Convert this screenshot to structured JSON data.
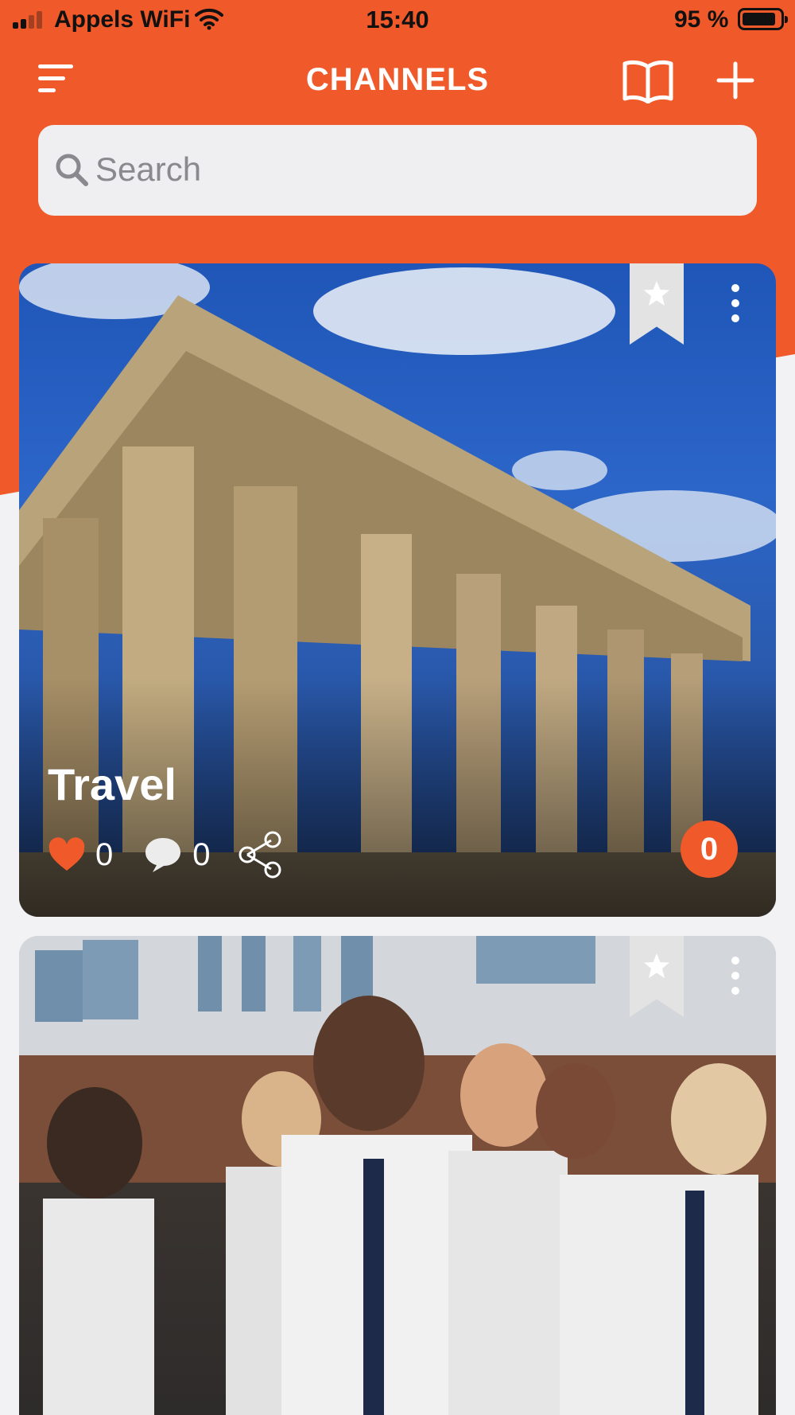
{
  "status_bar": {
    "carrier": "Appels WiFi",
    "time": "15:40",
    "battery": "95 %"
  },
  "header": {
    "title": "CHANNELS",
    "menu_icon": "hamburger-menu-icon",
    "book_icon": "open-book-icon",
    "add_icon": "plus-icon"
  },
  "search": {
    "placeholder": "Search",
    "icon": "magnifier-icon"
  },
  "colors": {
    "accent": "#f0592a",
    "search_bg": "#efeff1",
    "bookmark_bg": "#e3e3e3"
  },
  "cards": [
    {
      "title": "Travel",
      "likes": "0",
      "comments": "0",
      "badge": "0",
      "image": "parthenon-columns-blue-sky-photo"
    },
    {
      "title": "",
      "image": "students-in-school-uniform-photo"
    }
  ]
}
